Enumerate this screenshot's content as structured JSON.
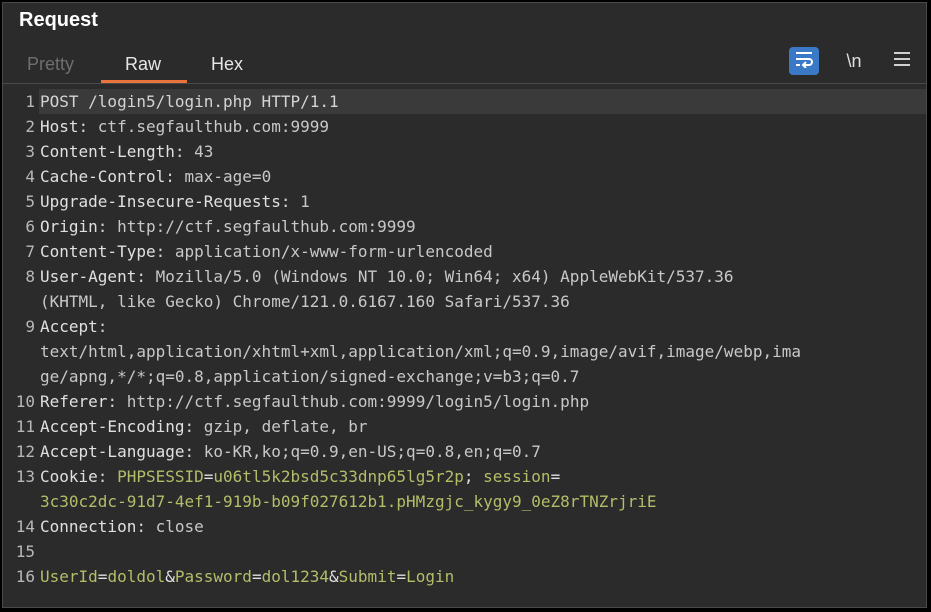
{
  "panel": {
    "title": "Request"
  },
  "tabs": [
    {
      "label": "Pretty",
      "active": false
    },
    {
      "label": "Raw",
      "active": true
    },
    {
      "label": "Hex",
      "active": false
    }
  ],
  "toolbar": {
    "wrap_icon": "wrap-lines-icon",
    "newline_label": "\\n",
    "menu_icon": "hamburger-menu-icon"
  },
  "colors": {
    "accent_underline": "#e8743b",
    "wrap_button": "#3a79c6",
    "cookie_value": "#b5bd68"
  },
  "lines": {
    "l1": {
      "num": "1",
      "text": "POST /login5/login.php HTTP/1.1"
    },
    "l2": {
      "num": "2",
      "name": "Host",
      "value": "ctf.segfaulthub.com:9999"
    },
    "l3": {
      "num": "3",
      "name": "Content-Length",
      "value": "43"
    },
    "l4": {
      "num": "4",
      "name": "Cache-Control",
      "value": "max-age=0"
    },
    "l5": {
      "num": "5",
      "name": "Upgrade-Insecure-Requests",
      "value": "1"
    },
    "l6": {
      "num": "6",
      "name": "Origin",
      "value": "http://ctf.segfaulthub.com:9999"
    },
    "l7": {
      "num": "7",
      "name": "Content-Type",
      "value": "application/x-www-form-urlencoded"
    },
    "l8": {
      "num": "8",
      "name": "User-Agent",
      "value_a": "Mozilla/5.0 (Windows NT 10.0; Win64; x64) AppleWebKit/537.36",
      "value_b": "(KHTML, like Gecko) Chrome/121.0.6167.160 Safari/537.36"
    },
    "l9": {
      "num": "9",
      "name": "Accept",
      "value_a": "text/html,application/xhtml+xml,application/xml;q=0.9,image/avif,image/webp,ima",
      "value_b": "ge/apng,*/*;q=0.8,application/signed-exchange;v=b3;q=0.7"
    },
    "l10": {
      "num": "10",
      "name": "Referer",
      "value": "http://ctf.segfaulthub.com:9999/login5/login.php"
    },
    "l11": {
      "num": "11",
      "name": "Accept-Encoding",
      "value": "gzip, deflate, br"
    },
    "l12": {
      "num": "12",
      "name": "Accept-Language",
      "value": "ko-KR,ko;q=0.9,en-US;q=0.8,en;q=0.7"
    },
    "l13": {
      "num": "13",
      "name": "Cookie",
      "key1": "PHPSESSID",
      "val1": "u06tl5k2bsd5c33dnp65lg5r2p",
      "key2": "session",
      "val2": "3c30c2dc-91d7-4ef1-919b-b09f027612b1.pHMzgjc_kygy9_0eZ8rTNZrjriE"
    },
    "l14": {
      "num": "14",
      "name": "Connection",
      "value": "close"
    },
    "l15": {
      "num": "15"
    },
    "l16": {
      "num": "16",
      "k1": "UserId",
      "v1": "doldol",
      "k2": "Password",
      "v2": "dol1234",
      "k3": "Submit",
      "v3": "Login"
    }
  }
}
